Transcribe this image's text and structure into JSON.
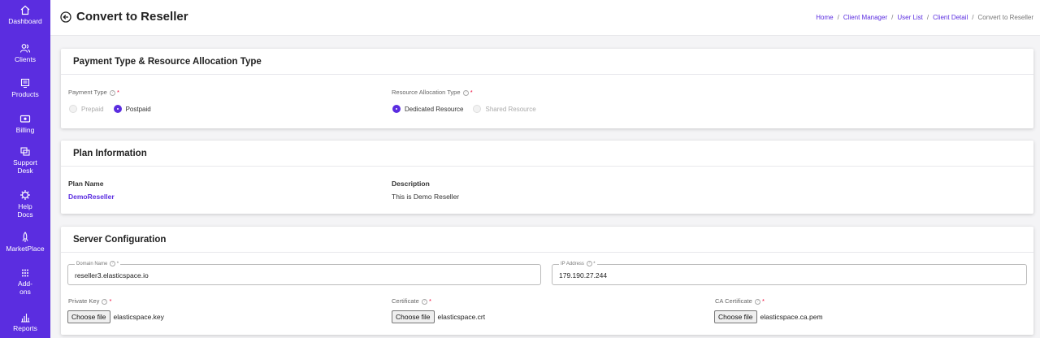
{
  "sidebar": {
    "items": [
      {
        "label": "Dashboard",
        "icon": "home-icon"
      },
      {
        "label": "Clients",
        "icon": "users-icon"
      },
      {
        "label": "Products",
        "icon": "products-icon"
      },
      {
        "label": "Billing",
        "icon": "billing-icon"
      },
      {
        "label": "Support Desk",
        "icon": "support-icon"
      },
      {
        "label": "Help Docs",
        "icon": "help-icon"
      },
      {
        "label": "MarketPlace",
        "icon": "rocket-icon"
      },
      {
        "label": "Add-ons",
        "icon": "grid-icon"
      },
      {
        "label": "Reports",
        "icon": "chart-icon"
      }
    ]
  },
  "header": {
    "title": "Convert to Reseller",
    "breadcrumb": [
      "Home",
      "Client Manager",
      "User List",
      "Client Detail",
      "Convert to Reseller"
    ]
  },
  "payment": {
    "title": "Payment Type & Resource Allocation Type",
    "payment_type_label": "Payment Type",
    "payment_options": [
      "Prepaid",
      "Postpaid"
    ],
    "payment_selected": "Postpaid",
    "resource_label": "Resource Allocation Type",
    "resource_options": [
      "Dedicated Resource",
      "Shared Resource"
    ],
    "resource_selected": "Dedicated Resource"
  },
  "plan": {
    "title": "Plan Information",
    "name_header": "Plan Name",
    "desc_header": "Description",
    "name": "DemoReseller",
    "description": "This is Demo Reseller"
  },
  "server": {
    "title": "Server Configuration",
    "domain_label": "Domain Name",
    "domain_value": "reseller3.elasticspace.io",
    "ip_label": "IP Address",
    "ip_value": "179.190.27.244",
    "private_key_label": "Private Key",
    "private_key_file": "elasticspace.key",
    "certificate_label": "Certificate",
    "certificate_file": "elasticspace.crt",
    "ca_certificate_label": "CA Certificate",
    "ca_certificate_file": "elasticspace.ca.pem",
    "choose_file_label": "Choose file"
  },
  "colors": {
    "accent": "#5b2de0",
    "required": "#e00033"
  }
}
